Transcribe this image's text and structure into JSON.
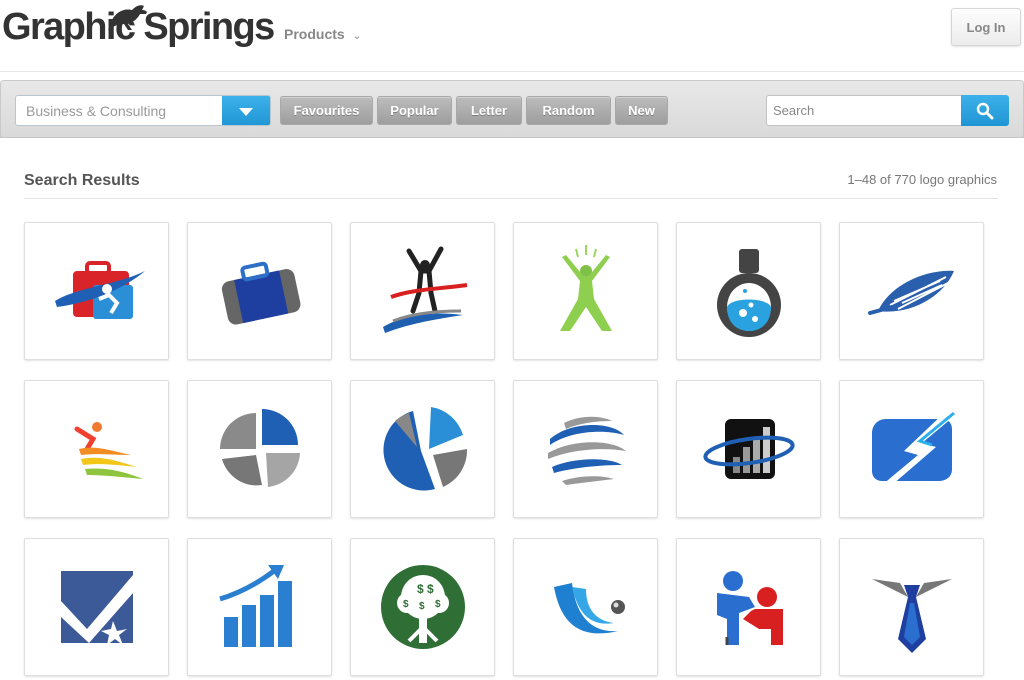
{
  "header": {
    "logo_text": "Graphic Springs",
    "nav": {
      "products_label": "Products"
    },
    "login_label": "Log In"
  },
  "toolbar": {
    "category_value": "Business & Consulting",
    "filter_buttons": [
      {
        "label": "Favourites"
      },
      {
        "label": "Popular"
      },
      {
        "label": "Letter"
      },
      {
        "label": "Random"
      },
      {
        "label": "New"
      }
    ],
    "search_placeholder": "Search"
  },
  "results": {
    "title": "Search Results",
    "count_text": "1–48 of 770 logo graphics"
  },
  "logos": [
    {
      "icon": "briefcase-runner-icon"
    },
    {
      "icon": "briefcase-icon"
    },
    {
      "icon": "finish-line-runner-icon"
    },
    {
      "icon": "green-person-icon"
    },
    {
      "icon": "flask-icon"
    },
    {
      "icon": "leaf-stripes-icon"
    },
    {
      "icon": "rainbow-figure-icon"
    },
    {
      "icon": "gray-pie-chart-icon"
    },
    {
      "icon": "blue-pie-chart-icon"
    },
    {
      "icon": "striped-globe-icon"
    },
    {
      "icon": "bar-chart-orbit-icon"
    },
    {
      "icon": "blue-bolt-icon"
    },
    {
      "icon": "checkmark-star-icon"
    },
    {
      "icon": "growth-arrow-chart-icon"
    },
    {
      "icon": "money-tree-icon"
    },
    {
      "icon": "blue-wave-icon"
    },
    {
      "icon": "handshake-people-icon"
    },
    {
      "icon": "necktie-icon"
    }
  ],
  "colors": {
    "accent_blue": "#1f95d4",
    "filter_gray": "#a8a8a8"
  }
}
